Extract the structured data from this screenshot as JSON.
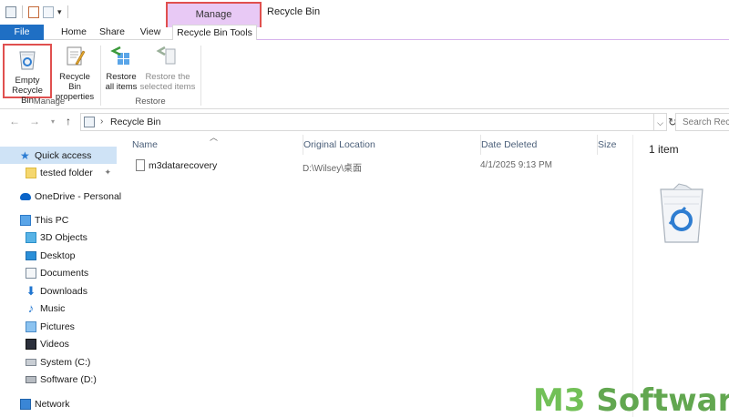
{
  "window": {
    "title": "Recycle Bin",
    "context_tab": "Manage"
  },
  "ribbon_tabs": {
    "file": "File",
    "home": "Home",
    "share": "Share",
    "view": "View",
    "tools": "Recycle Bin Tools"
  },
  "ribbon": {
    "empty_line1": "Empty",
    "empty_line2": "Recycle Bin",
    "props_line1": "Recycle Bin",
    "props_line2": "properties",
    "restore_all_line1": "Restore",
    "restore_all_line2": "all items",
    "restore_sel_line1": "Restore the",
    "restore_sel_line2": "selected items",
    "group_manage": "Manage",
    "group_restore": "Restore"
  },
  "address": {
    "path": "Recycle Bin",
    "search_placeholder": "Search Recycle Bin"
  },
  "nav": {
    "quick_access": "Quick access",
    "tested_folder": "tested folder",
    "onedrive": "OneDrive - Personal",
    "this_pc": "This PC",
    "objects3d": "3D Objects",
    "desktop": "Desktop",
    "documents": "Documents",
    "downloads": "Downloads",
    "music": "Music",
    "pictures": "Pictures",
    "videos": "Videos",
    "system_c": "System (C:)",
    "software_d": "Software (D:)",
    "network": "Network"
  },
  "columns": {
    "name": "Name",
    "original_location": "Original Location",
    "date_deleted": "Date Deleted",
    "size": "Size"
  },
  "files": [
    {
      "name": "m3datarecovery",
      "original_location": "D:\\Wilsey\\桌面",
      "date_deleted": "4/1/2025 9:13 PM"
    }
  ],
  "details": {
    "item_count": "1 item"
  },
  "watermark": {
    "text_m3": "M3",
    "text_rest": " Software"
  },
  "colors": {
    "file_tab": "#1f6fc4",
    "manage_tab": "#e8c9f5",
    "highlight_border": "#e0504f",
    "nav_selected": "#cfe3f6",
    "watermark": "#5aa347"
  }
}
